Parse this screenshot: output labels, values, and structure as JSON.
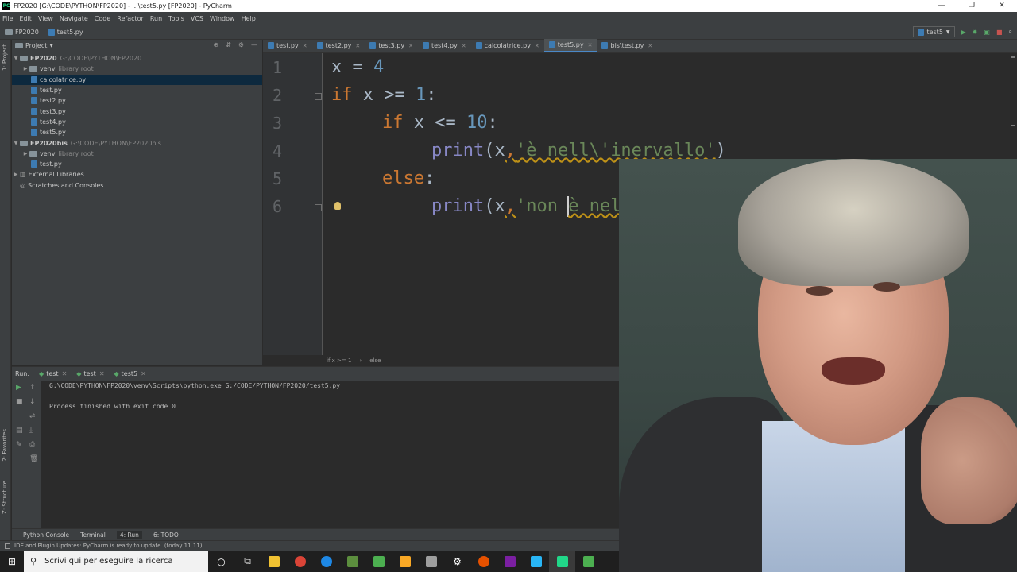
{
  "window": {
    "title": "FP2020 [G:\\CODE\\PYTHON\\FP2020] - ...\\test5.py [FP2020] - PyCharm",
    "controls": [
      "—",
      "❐",
      "✕"
    ]
  },
  "menu": [
    "File",
    "Edit",
    "View",
    "Navigate",
    "Code",
    "Refactor",
    "Run",
    "Tools",
    "VCS",
    "Window",
    "Help"
  ],
  "navbar": {
    "project": "FP2020",
    "file": "test5.py",
    "run_config": "test5"
  },
  "sidebar_tabs": {
    "project": "1: Project",
    "favorites": "2: Favorites",
    "structure": "Z: Structure"
  },
  "project_panel": {
    "title": "Project",
    "tree": [
      {
        "label": "FP2020",
        "hint": "G:\\CODE\\PYTHON\\FP2020",
        "bold": true
      },
      {
        "label": "venv",
        "hint": "library root"
      },
      {
        "label": "calcolatrice.py"
      },
      {
        "label": "test.py"
      },
      {
        "label": "test2.py"
      },
      {
        "label": "test3.py"
      },
      {
        "label": "test4.py"
      },
      {
        "label": "test5.py"
      },
      {
        "label": "FP2020bis",
        "hint": "G:\\CODE\\PYTHON\\FP2020bis",
        "bold": true
      },
      {
        "label": "venv",
        "hint": "library root"
      },
      {
        "label": "test.py"
      },
      {
        "label": "External Libraries"
      },
      {
        "label": "Scratches and Consoles"
      }
    ]
  },
  "editor_tabs": [
    "test.py",
    "test2.py",
    "test3.py",
    "test4.py",
    "calcolatrice.py",
    "test5.py",
    "bis\\test.py"
  ],
  "active_tab": "test5.py",
  "code": {
    "line_numbers": [
      "1",
      "2",
      "3",
      "4",
      "5",
      "6"
    ],
    "l1": {
      "var": "x",
      "op": " = ",
      "num": "4"
    },
    "l2": {
      "kw": "if",
      "rest": " x >= ",
      "num": "1",
      "end": ":"
    },
    "l3": {
      "kw": "if",
      "rest": " x <= ",
      "num": "10",
      "end": ":"
    },
    "l4": {
      "fn": "print",
      "open": "(x",
      "comma": ",",
      "str": "'è nell\\'inervallo'",
      "close": ")"
    },
    "l5": {
      "kw": "else",
      "end": ":"
    },
    "l6": {
      "fn": "print",
      "open": "(x",
      "comma": ",",
      "str_before_caret": "'non ",
      "str_after_caret": "è nell\\'inervallo'",
      "close": ")"
    }
  },
  "editor_breadcrumb": [
    "if x >= 1",
    "else"
  ],
  "run_panel": {
    "label": "Run:",
    "tabs": [
      "test",
      "test",
      "test5"
    ],
    "console": [
      "G:\\CODE\\PYTHON\\FP2020\\venv\\Scripts\\python.exe G:/CODE/PYTHON/FP2020/test5.py",
      "",
      "Process finished with exit code 0"
    ]
  },
  "bottom_tabs": [
    "Python Console",
    "Terminal",
    "4: Run",
    "6: TODO"
  ],
  "status": "IDE and Plugin Updates: PyCharm is ready to update. (today 11.11)",
  "taskbar": {
    "search_placeholder": "Scrivi qui per eseguire la ricerca",
    "icon_colors": [
      "#f1c232",
      "#db4437",
      "#1e88e5",
      "#5c8e3e",
      "#4caf50",
      "#f9a825",
      "#9e9e9e",
      "#e65100",
      "#7b1fa2",
      "#29b6f6",
      "#21d789",
      "#4caf50"
    ]
  }
}
